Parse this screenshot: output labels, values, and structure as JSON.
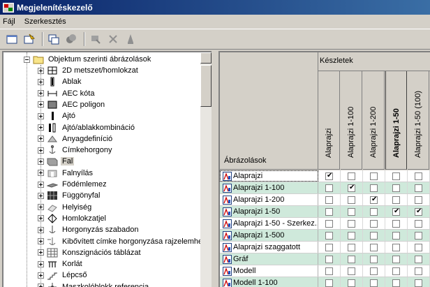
{
  "window": {
    "title": "Megjelenítéskezelő"
  },
  "menu": [
    "Fájl",
    "Szerkesztés"
  ],
  "toolbar": {
    "buttons": [
      "new-icon",
      "new-style-icon",
      "copy-icon",
      "paste-icon",
      "purge-icon",
      "delete-icon",
      "edit-icon"
    ]
  },
  "tree": {
    "root_label": "Objektum szerinti ábrázolások",
    "items": [
      {
        "label": "2D metszet/homlokzat",
        "icon": "section-icon"
      },
      {
        "label": "Ablak",
        "icon": "window-icon"
      },
      {
        "label": "AEC kóta",
        "icon": "dimension-icon"
      },
      {
        "label": "AEC poligon",
        "icon": "polygon-icon"
      },
      {
        "label": "Ajtó",
        "icon": "door-icon"
      },
      {
        "label": "Ajtó/ablakkombináció",
        "icon": "door-window-icon"
      },
      {
        "label": "Anyagdefiníció",
        "icon": "material-icon"
      },
      {
        "label": "Címkehorgony",
        "icon": "anchor-icon"
      },
      {
        "label": "Fal",
        "icon": "wall-icon",
        "selected": true
      },
      {
        "label": "Falnyílás",
        "icon": "opening-icon"
      },
      {
        "label": "Födémlemez",
        "icon": "slab-icon"
      },
      {
        "label": "Függönyfal",
        "icon": "curtain-wall-icon"
      },
      {
        "label": "Helyiség",
        "icon": "space-icon"
      },
      {
        "label": "Homlokzatjel",
        "icon": "elevation-mark-icon"
      },
      {
        "label": "Horgonyzás szabadon",
        "icon": "anchor-free-icon"
      },
      {
        "label": "Kibővített címke horgonyzása rajzelemhez",
        "icon": "tag-anchor-icon"
      },
      {
        "label": "Konszignációs táblázat",
        "icon": "schedule-table-icon"
      },
      {
        "label": "Korlát",
        "icon": "railing-icon"
      },
      {
        "label": "Lépcső",
        "icon": "stair-icon"
      },
      {
        "label": "Maszkolóblokk referencia",
        "icon": "mask-block-icon"
      }
    ]
  },
  "grid": {
    "first_col_header": "Ábrázolások",
    "group_header": "Készletek",
    "columns": [
      "Alaprajzi",
      "Alaprajzi 1-100",
      "Alaprajzi 1-200",
      "Alaprajzi 1-50",
      "Alaprajzi 1-50 (100)"
    ],
    "bold_column": 3,
    "rows": [
      {
        "name": "Alaprajzi",
        "checks": [
          true,
          false,
          false,
          false,
          false
        ]
      },
      {
        "name": "Alaprajzi 1-100",
        "checks": [
          false,
          true,
          false,
          false,
          false
        ]
      },
      {
        "name": "Alaprajzi 1-200",
        "checks": [
          false,
          false,
          true,
          false,
          false
        ]
      },
      {
        "name": "Alaprajzi 1-50",
        "checks": [
          false,
          false,
          false,
          true,
          true
        ]
      },
      {
        "name": "Alaprajzi 1-50 - Szerkez...",
        "checks": [
          false,
          false,
          false,
          false,
          false
        ]
      },
      {
        "name": "Alaprajzi 1-500",
        "checks": [
          false,
          false,
          false,
          false,
          false
        ]
      },
      {
        "name": "Alaprajzi szaggatott",
        "checks": [
          false,
          false,
          false,
          false,
          false
        ]
      },
      {
        "name": "Gráf",
        "checks": [
          false,
          false,
          false,
          false,
          false
        ]
      },
      {
        "name": "Modell",
        "checks": [
          false,
          false,
          false,
          false,
          false
        ]
      },
      {
        "name": "Modell 1-100",
        "checks": [
          false,
          false,
          false,
          false,
          false
        ]
      },
      {
        "name": "Modell 1-200",
        "checks": [
          false,
          false,
          false,
          false,
          false
        ]
      }
    ]
  }
}
